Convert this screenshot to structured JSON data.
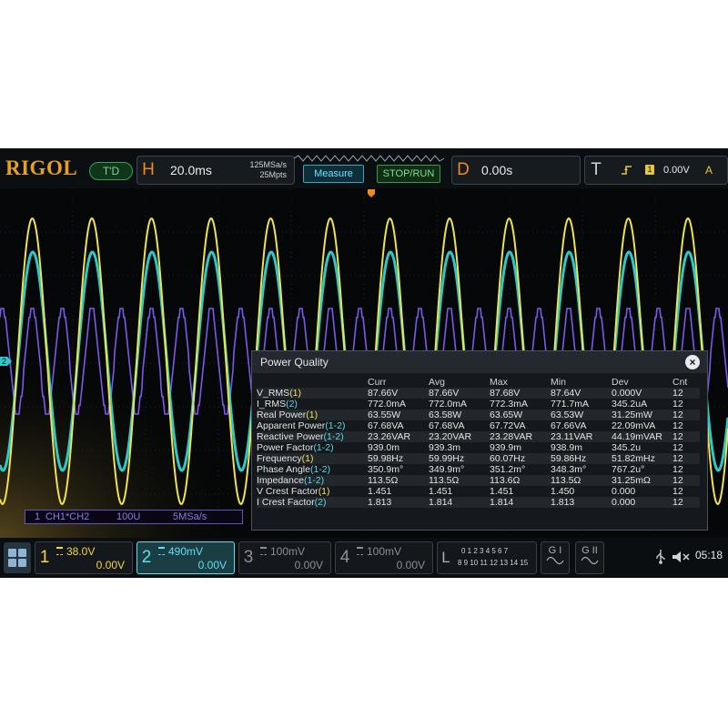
{
  "top_bar": {
    "logo": "RIGOL",
    "trigger_mode": "T'D",
    "horizontal": {
      "letter": "H",
      "timebase": "20.0ms",
      "sample_rate": "125MSa/s",
      "memory_depth": "25Mpts"
    },
    "measure_label": "Measure",
    "run_stop_label": "STOP/RUN",
    "delay": {
      "letter": "D",
      "value": "0.00s"
    },
    "trigger": {
      "letter": "T",
      "slope_icon": "rising-edge-icon",
      "source_badge": "1",
      "level": "0.00V",
      "coupling": "A"
    }
  },
  "power_quality": {
    "title": "Power Quality",
    "close_label": "×",
    "columns": [
      "",
      "Curr",
      "Avg",
      "Max",
      "Min",
      "Dev",
      "Cnt"
    ],
    "rows": [
      {
        "name": "V_RMS",
        "src": "(1)",
        "src_color": "yellow",
        "curr": "87.66V",
        "avg": "87.66V",
        "max": "87.68V",
        "min": "87.64V",
        "dev": "0.000V",
        "cnt": "12"
      },
      {
        "name": "I_RMS",
        "src": "(2)",
        "src_color": "cyan",
        "curr": "772.0mA",
        "avg": "772.0mA",
        "max": "772.3mA",
        "min": "771.7mA",
        "dev": "345.2uA",
        "cnt": "12"
      },
      {
        "name": "Real Power",
        "src": "(1)",
        "src_color": "yellow",
        "curr": "63.55W",
        "avg": "63.58W",
        "max": "63.65W",
        "min": "63.53W",
        "dev": "31.25mW",
        "cnt": "12"
      },
      {
        "name": "Apparent Power",
        "src": "(1-2)",
        "src_color": "cyan",
        "curr": "67.68VA",
        "avg": "67.68VA",
        "max": "67.72VA",
        "min": "67.66VA",
        "dev": "22.09mVA",
        "cnt": "12"
      },
      {
        "name": "Reactive Power",
        "src": "(1-2)",
        "src_color": "cyan",
        "curr": "23.26VAR",
        "avg": "23.20VAR",
        "max": "23.28VAR",
        "min": "23.11VAR",
        "dev": "44.19mVAR",
        "cnt": "12"
      },
      {
        "name": "Power Factor",
        "src": "(1-2)",
        "src_color": "cyan",
        "curr": "939.0m",
        "avg": "939.3m",
        "max": "939.9m",
        "min": "938.9m",
        "dev": "345.2u",
        "cnt": "12"
      },
      {
        "name": "Frequency",
        "src": "(1)",
        "src_color": "yellow",
        "curr": "59.98Hz",
        "avg": "59.99Hz",
        "max": "60.07Hz",
        "min": "59.86Hz",
        "dev": "51.82mHz",
        "cnt": "12"
      },
      {
        "name": "Phase Angle",
        "src": "(1-2)",
        "src_color": "cyan",
        "curr": "350.9m°",
        "avg": "349.9m°",
        "max": "351.2m°",
        "min": "348.3m°",
        "dev": "767.2u°",
        "cnt": "12"
      },
      {
        "name": "Impedance",
        "src": "(1-2)",
        "src_color": "cyan",
        "curr": "113.5Ω",
        "avg": "113.5Ω",
        "max": "113.6Ω",
        "min": "113.5Ω",
        "dev": "31.25mΩ",
        "cnt": "12"
      },
      {
        "name": "V Crest Factor",
        "src": "(1)",
        "src_color": "yellow",
        "curr": "1.451",
        "avg": "1.451",
        "max": "1.451",
        "min": "1.450",
        "dev": "0.000",
        "cnt": "12"
      },
      {
        "name": "I Crest Factor",
        "src": "(2)",
        "src_color": "cyan",
        "curr": "1.813",
        "avg": "1.814",
        "max": "1.814",
        "min": "1.813",
        "dev": "0.000",
        "cnt": "12"
      }
    ]
  },
  "math_label": {
    "channel": "1",
    "expr": "CH1*CH2",
    "scale": "100U",
    "rate": "5MSa/s"
  },
  "ch2_marker": "2",
  "bottom_bar": {
    "channels": [
      {
        "num": "1",
        "scale": "38.0V",
        "offset": "0.00V",
        "color": "#f0d640"
      },
      {
        "num": "2",
        "scale": "490mV",
        "offset": "0.00V",
        "color": "#5fe0ee"
      },
      {
        "num": "3",
        "scale": "100mV",
        "offset": "0.00V",
        "color": "#8a8f95"
      },
      {
        "num": "4",
        "scale": "100mV",
        "offset": "0.00V",
        "color": "#8a8f95"
      }
    ],
    "logic_letter": "L",
    "logic_row1": "0 1 2 3  4 5 6 7",
    "logic_row2": "8 9 10 11 12 13 14 15",
    "gen1": "G I",
    "gen2": "G II",
    "time": "05:18"
  }
}
